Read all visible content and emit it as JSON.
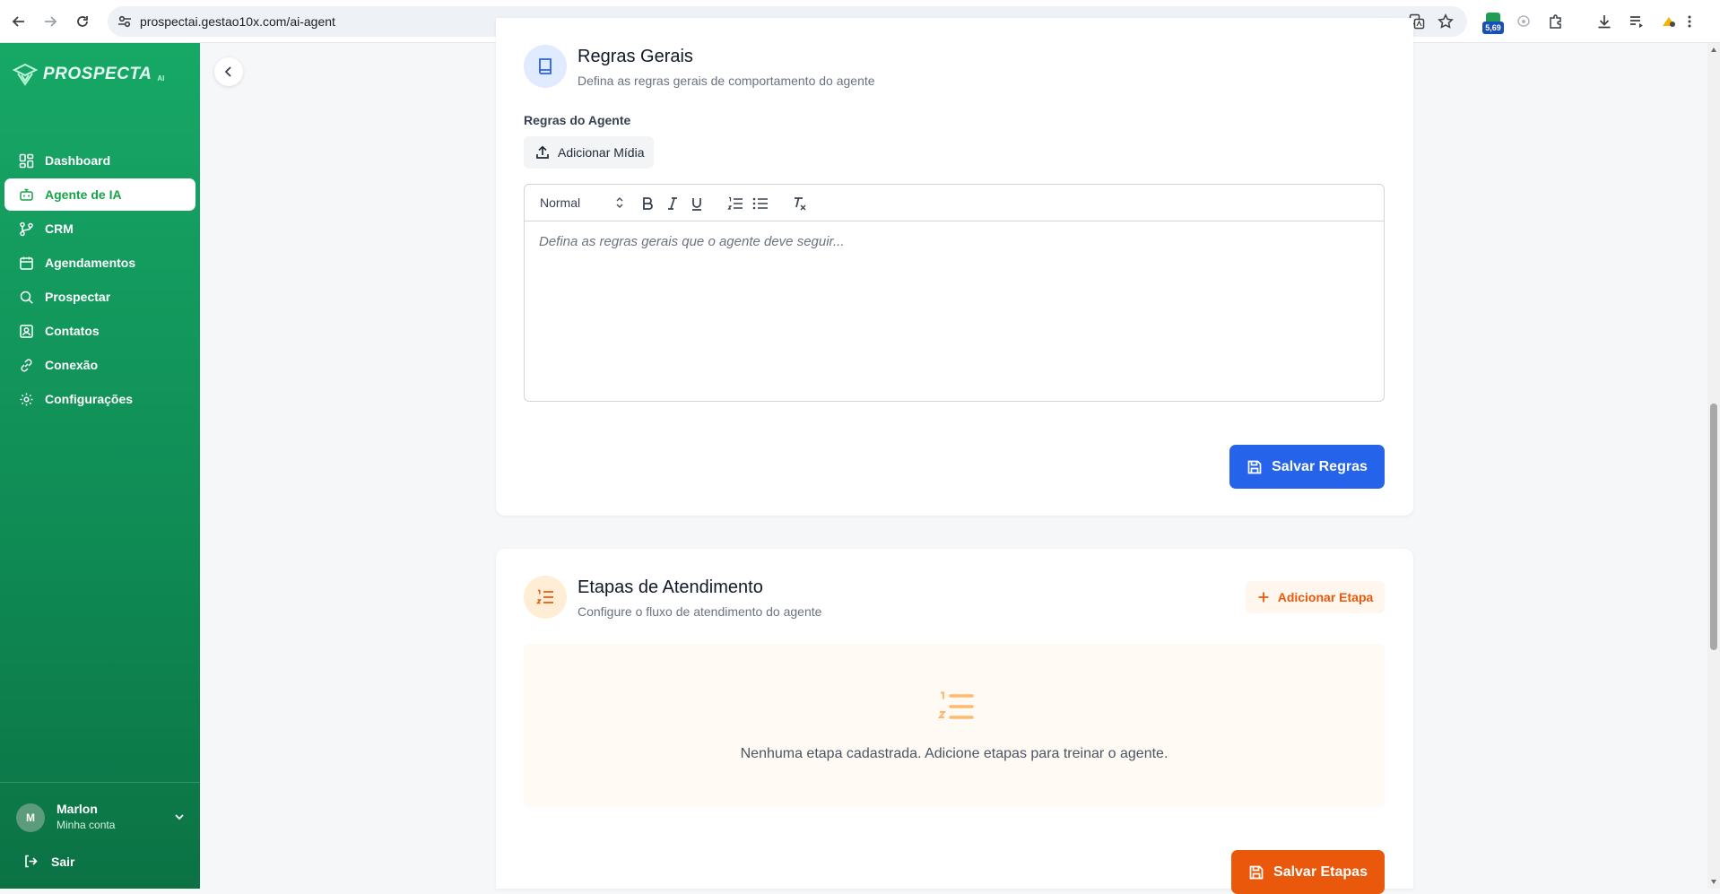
{
  "browser": {
    "url": "prospectai.gestao10x.com/ai-agent",
    "extension_badge": "5,69"
  },
  "sidebar": {
    "logo_text": "PROSPECTA",
    "logo_sub": "AI",
    "items": [
      {
        "label": "Dashboard",
        "icon": "dashboard-icon",
        "active": false
      },
      {
        "label": "Agente de IA",
        "icon": "bot-icon",
        "active": true
      },
      {
        "label": "CRM",
        "icon": "git-branch-icon",
        "active": false
      },
      {
        "label": "Agendamentos",
        "icon": "calendar-icon",
        "active": false
      },
      {
        "label": "Prospectar",
        "icon": "search-icon",
        "active": false
      },
      {
        "label": "Contatos",
        "icon": "contacts-icon",
        "active": false
      },
      {
        "label": "Conexão",
        "icon": "link-icon",
        "active": false
      },
      {
        "label": "Configurações",
        "icon": "gear-icon",
        "active": false
      }
    ],
    "user": {
      "initial": "M",
      "name": "Marlon",
      "subtitle": "Minha conta"
    },
    "logout_label": "Sair"
  },
  "rules_section": {
    "title": "Regras Gerais",
    "subtitle": "Defina as regras gerais de comportamento do agente",
    "field_label": "Regras do Agente",
    "add_media_label": "Adicionar Mídia",
    "editor": {
      "format_select": "Normal",
      "placeholder": "Defina as regras gerais que o agente deve seguir..."
    },
    "save_label": "Salvar Regras"
  },
  "steps_section": {
    "title": "Etapas de Atendimento",
    "subtitle": "Configure o fluxo de atendimento do agente",
    "add_label": "Adicionar Etapa",
    "empty_text": "Nenhuma etapa cadastrada. Adicione etapas para treinar o agente.",
    "save_label": "Salvar Etapas"
  },
  "colors": {
    "sidebar_green": "#17a866",
    "primary_blue": "#2563eb",
    "accent_orange": "#ea580c"
  }
}
